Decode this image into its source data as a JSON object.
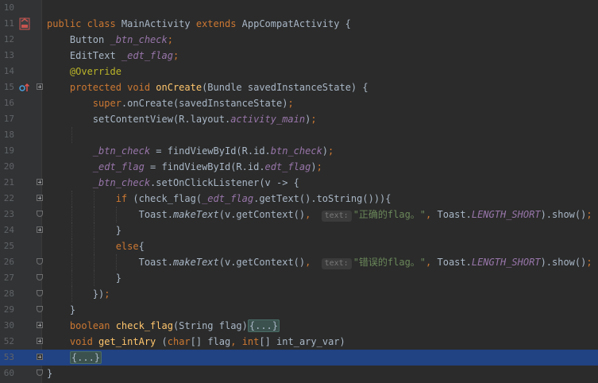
{
  "editor": {
    "lines": [
      {
        "num": "10",
        "tokens": []
      },
      {
        "num": "11",
        "tokens": [
          {
            "t": "public class ",
            "c": "kw"
          },
          {
            "t": "MainActivity ",
            "c": ""
          },
          {
            "t": "extends ",
            "c": "kw"
          },
          {
            "t": "AppCompatActivity {",
            "c": ""
          }
        ]
      },
      {
        "num": "12",
        "tokens": [
          {
            "t": "    Button ",
            "c": ""
          },
          {
            "t": "_btn_check",
            "c": "fi"
          },
          {
            "t": ";",
            "c": "kw"
          }
        ]
      },
      {
        "num": "13",
        "tokens": [
          {
            "t": "    EditText ",
            "c": ""
          },
          {
            "t": "_edt_flag",
            "c": "fi"
          },
          {
            "t": ";",
            "c": "kw"
          }
        ]
      },
      {
        "num": "14",
        "tokens": [
          {
            "t": "    ",
            "c": ""
          },
          {
            "t": "@Override",
            "c": "an"
          }
        ]
      },
      {
        "num": "15",
        "tokens": [
          {
            "t": "    protected void ",
            "c": "kw"
          },
          {
            "t": "onCreate",
            "c": "fn"
          },
          {
            "t": "(Bundle savedInstanceState) {",
            "c": ""
          }
        ]
      },
      {
        "num": "16",
        "tokens": [
          {
            "t": "        super",
            "c": "kw"
          },
          {
            "t": ".onCreate(savedInstanceState)",
            "c": ""
          },
          {
            "t": ";",
            "c": "kw"
          }
        ]
      },
      {
        "num": "17",
        "tokens": [
          {
            "t": "        setContentView(R.layout.",
            "c": ""
          },
          {
            "t": "activity_main",
            "c": "fi"
          },
          {
            "t": ")",
            "c": ""
          },
          {
            "t": ";",
            "c": "kw"
          }
        ]
      },
      {
        "num": "18",
        "tokens": []
      },
      {
        "num": "19",
        "tokens": [
          {
            "t": "        ",
            "c": ""
          },
          {
            "t": "_btn_check",
            "c": "fi"
          },
          {
            "t": " = findViewById(R.id.",
            "c": ""
          },
          {
            "t": "btn_check",
            "c": "fi"
          },
          {
            "t": ")",
            "c": ""
          },
          {
            "t": ";",
            "c": "kw"
          }
        ]
      },
      {
        "num": "20",
        "tokens": [
          {
            "t": "        ",
            "c": ""
          },
          {
            "t": "_edt_flag",
            "c": "fi"
          },
          {
            "t": " = findViewById(R.id.",
            "c": ""
          },
          {
            "t": "edt_flag",
            "c": "fi"
          },
          {
            "t": ")",
            "c": ""
          },
          {
            "t": ";",
            "c": "kw"
          }
        ]
      },
      {
        "num": "21",
        "tokens": [
          {
            "t": "        ",
            "c": ""
          },
          {
            "t": "_btn_check",
            "c": "fi"
          },
          {
            "t": ".setOnClickListener(v -> {",
            "c": ""
          }
        ]
      },
      {
        "num": "22",
        "tokens": [
          {
            "t": "            if ",
            "c": "kw"
          },
          {
            "t": "(check_flag(",
            "c": ""
          },
          {
            "t": "_edt_flag",
            "c": "fi"
          },
          {
            "t": ".getText().toString())){",
            "c": ""
          }
        ]
      },
      {
        "num": "23",
        "tokens": [
          {
            "t": "                Toast.",
            "c": ""
          },
          {
            "t": "makeText",
            "c": "st"
          },
          {
            "t": "(v.getContext()",
            "c": ""
          },
          {
            "t": ", ",
            "c": "kw"
          },
          {
            "t": "text:",
            "c": "hint"
          },
          {
            "t": "\"正确的flag。\"",
            "c": "str"
          },
          {
            "t": ", ",
            "c": "kw"
          },
          {
            "t": "Toast.",
            "c": ""
          },
          {
            "t": "LENGTH_SHORT",
            "c": "fi"
          },
          {
            "t": ").show()",
            "c": ""
          },
          {
            "t": ";",
            "c": "kw"
          }
        ]
      },
      {
        "num": "24",
        "tokens": [
          {
            "t": "            }",
            "c": ""
          }
        ]
      },
      {
        "num": "25",
        "tokens": [
          {
            "t": "            else",
            "c": "kw"
          },
          {
            "t": "{",
            "c": ""
          }
        ]
      },
      {
        "num": "26",
        "tokens": [
          {
            "t": "                Toast.",
            "c": ""
          },
          {
            "t": "makeText",
            "c": "st"
          },
          {
            "t": "(v.getContext()",
            "c": ""
          },
          {
            "t": ", ",
            "c": "kw"
          },
          {
            "t": "text:",
            "c": "hint"
          },
          {
            "t": "\"错误的flag。\"",
            "c": "str"
          },
          {
            "t": ", ",
            "c": "kw"
          },
          {
            "t": "Toast.",
            "c": ""
          },
          {
            "t": "LENGTH_SHORT",
            "c": "fi"
          },
          {
            "t": ").show()",
            "c": ""
          },
          {
            "t": ";",
            "c": "kw"
          }
        ]
      },
      {
        "num": "27",
        "tokens": [
          {
            "t": "            }",
            "c": ""
          }
        ]
      },
      {
        "num": "28",
        "tokens": [
          {
            "t": "        })",
            "c": ""
          },
          {
            "t": ";",
            "c": "kw"
          }
        ]
      },
      {
        "num": "29",
        "tokens": [
          {
            "t": "    }",
            "c": ""
          }
        ]
      },
      {
        "num": "30",
        "tokens": [
          {
            "t": "    boolean ",
            "c": "kw"
          },
          {
            "t": "check_flag",
            "c": "fn"
          },
          {
            "t": "(String flag)",
            "c": ""
          },
          {
            "t": "{...}",
            "c": "fold"
          }
        ]
      },
      {
        "num": "52",
        "tokens": [
          {
            "t": "    void ",
            "c": "kw"
          },
          {
            "t": "get_intAry ",
            "c": "fn"
          },
          {
            "t": "(",
            "c": ""
          },
          {
            "t": "char",
            "c": "kw"
          },
          {
            "t": "[] flag",
            "c": ""
          },
          {
            "t": ", ",
            "c": "kw"
          },
          {
            "t": "int",
            "c": "kw"
          },
          {
            "t": "[] int_ary_var)",
            "c": ""
          }
        ]
      },
      {
        "num": "53",
        "tokens": [
          {
            "t": "    ",
            "c": ""
          },
          {
            "t": "{...}",
            "c": "fold"
          }
        ]
      },
      {
        "num": "60",
        "tokens": [
          {
            "t": "}",
            "c": ""
          }
        ]
      }
    ],
    "highlighted_line": 22,
    "icons": {
      "line11": "android-activity-icon",
      "line15": "override-method-icon"
    },
    "colors": {
      "background": "#2b2b2b",
      "gutter": "#313335",
      "keyword": "#cc7832",
      "function": "#ffc66d",
      "annotation": "#bbb529",
      "field": "#9876aa",
      "string": "#6a8759",
      "selection": "#214283"
    }
  }
}
